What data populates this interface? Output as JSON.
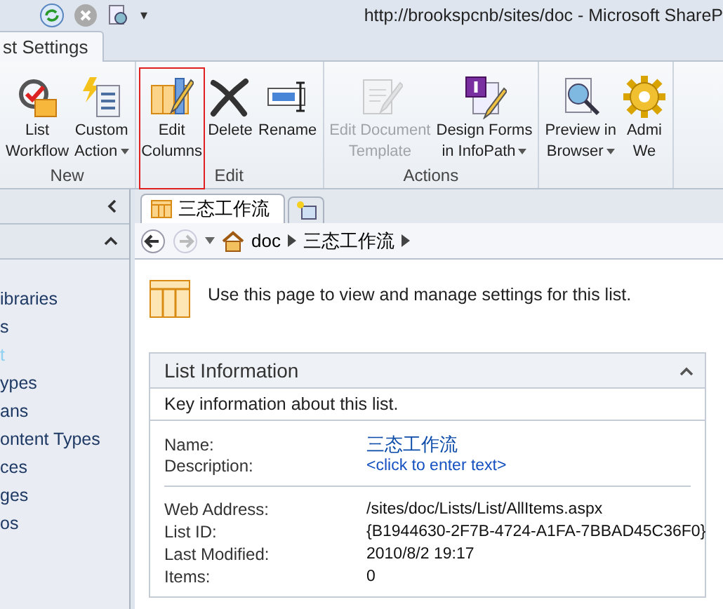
{
  "window": {
    "title": "http://brookspcnb/sites/doc  -  Microsoft ShareP"
  },
  "quick_access": {
    "menu_glyph": "▾"
  },
  "ribbon_tabs": [
    {
      "label": "st Settings",
      "selected": true
    }
  ],
  "ribbon_groups": [
    {
      "label": "New",
      "buttons": [
        {
          "kind": "workflow",
          "lines": [
            "List",
            "Workflow"
          ],
          "dropdown": false,
          "disabled": false,
          "highlighted": false
        },
        {
          "kind": "action",
          "lines": [
            "Custom",
            "Action"
          ],
          "dropdown": true,
          "disabled": false,
          "highlighted": false
        }
      ]
    },
    {
      "label": "Edit",
      "buttons": [
        {
          "kind": "columns",
          "lines": [
            "Edit",
            "Columns"
          ],
          "dropdown": false,
          "disabled": false,
          "highlighted": true
        },
        {
          "kind": "delete",
          "lines": [
            "Delete"
          ],
          "dropdown": false,
          "disabled": false,
          "highlighted": false
        },
        {
          "kind": "rename",
          "lines": [
            "Rename"
          ],
          "dropdown": false,
          "disabled": false,
          "highlighted": false
        }
      ]
    },
    {
      "label": "Actions",
      "buttons": [
        {
          "kind": "template",
          "lines": [
            "Edit Document",
            "Template"
          ],
          "dropdown": false,
          "disabled": true,
          "highlighted": false
        },
        {
          "kind": "infopath",
          "lines": [
            "Design Forms",
            "in InfoPath"
          ],
          "dropdown": true,
          "disabled": false,
          "highlighted": false
        }
      ]
    },
    {
      "buttons": [
        {
          "kind": "preview",
          "lines": [
            "Preview in",
            "Browser"
          ],
          "dropdown": true,
          "disabled": false,
          "highlighted": false
        },
        {
          "kind": "admin",
          "lines": [
            "Admi",
            "We"
          ],
          "dropdown": false,
          "disabled": false,
          "highlighted": false
        }
      ]
    }
  ],
  "sidebar": {
    "items": [
      {
        "label": "ibraries",
        "selected": false
      },
      {
        "label": "s",
        "selected": false
      },
      {
        "label": "t",
        "selected": true
      },
      {
        "label": "ypes",
        "selected": false
      },
      {
        "label": "ans",
        "selected": false
      },
      {
        "label": "ontent Types",
        "selected": false
      },
      {
        "label": "ces",
        "selected": false
      },
      {
        "label": "ges",
        "selected": false
      },
      {
        "label": "os",
        "selected": false
      }
    ]
  },
  "doc_tabs": [
    {
      "label": "三态工作流",
      "selected": true
    }
  ],
  "breadcrumb": [
    "doc",
    "三态工作流"
  ],
  "intro": "Use this page to view and manage settings for this list.",
  "panel": {
    "title": "List Information",
    "subtitle": "Key information about this list.",
    "groups": [
      [
        {
          "label": "Name:",
          "value": "三态工作流",
          "kind": "title"
        },
        {
          "label": "Description:",
          "value": "<click to enter text>",
          "kind": "link"
        }
      ],
      [
        {
          "label": "Web Address:",
          "value": "/sites/doc/Lists/List/AllItems.aspx",
          "kind": "text"
        },
        {
          "label": "List ID:",
          "value": "{B1944630-2F7B-4724-A1FA-7BBAD45C36F0}",
          "kind": "text"
        },
        {
          "label": "Last Modified:",
          "value": "2010/8/2 19:17",
          "kind": "text"
        },
        {
          "label": "Items:",
          "value": "0",
          "kind": "text"
        }
      ]
    ]
  }
}
